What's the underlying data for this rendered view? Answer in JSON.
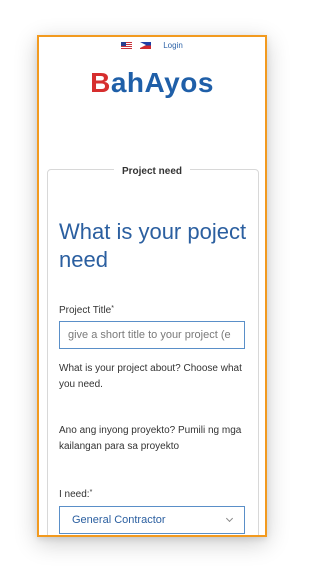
{
  "header": {
    "login_label": "Login",
    "flags": [
      {
        "name": "us-flag-icon"
      },
      {
        "name": "ph-flag-icon"
      }
    ]
  },
  "logo": {
    "first_letter": "B",
    "rest": "ahAyos"
  },
  "section": {
    "legend": "Project need",
    "heading": "What is your poject need"
  },
  "form": {
    "project_title_label": "Project Title",
    "required_mark": "*",
    "project_title_placeholder": "give a short title to your project (e",
    "about_en": "What is your project about? Choose what you need.",
    "about_tl": "Ano ang inyong proyekto? Pumili ng mga kailangan para sa proyekto",
    "need_label": "I need:",
    "need_selected": "General Contractor"
  },
  "colors": {
    "accent_border": "#f29a1f",
    "brand_blue": "#1f5fa8",
    "brand_red": "#d62e2e"
  }
}
